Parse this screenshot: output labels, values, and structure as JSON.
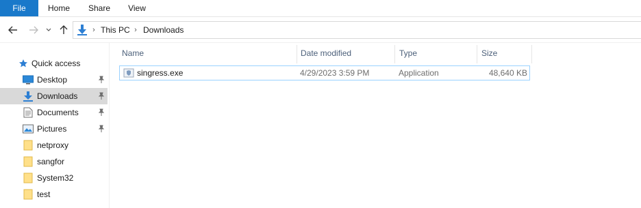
{
  "ribbon": {
    "tabs": [
      {
        "label": "File"
      },
      {
        "label": "Home"
      },
      {
        "label": "Share"
      },
      {
        "label": "View"
      }
    ]
  },
  "address": {
    "crumbs": [
      "This PC",
      "Downloads"
    ]
  },
  "sidebar": {
    "header": "Quick access",
    "items": [
      {
        "label": "Desktop",
        "icon": "desktop-icon",
        "pinned": true
      },
      {
        "label": "Downloads",
        "icon": "downloads-icon",
        "pinned": true,
        "selected": true
      },
      {
        "label": "Documents",
        "icon": "documents-icon",
        "pinned": true
      },
      {
        "label": "Pictures",
        "icon": "pictures-icon",
        "pinned": true
      },
      {
        "label": "netproxy",
        "icon": "folder-icon",
        "pinned": false
      },
      {
        "label": "sangfor",
        "icon": "folder-icon",
        "pinned": false
      },
      {
        "label": "System32",
        "icon": "folder-icon",
        "pinned": false
      },
      {
        "label": "test",
        "icon": "folder-icon",
        "pinned": false
      }
    ]
  },
  "columns": {
    "name": "Name",
    "date": "Date modified",
    "type": "Type",
    "size": "Size"
  },
  "files": [
    {
      "name": "singress.exe",
      "date": "4/29/2023 3:59 PM",
      "type": "Application",
      "size": "48,640 KB",
      "icon": "exe-file-icon"
    }
  ],
  "colors": {
    "accent": "#1979ca",
    "selection": "#cce8ff",
    "header_text": "#4c607a"
  }
}
